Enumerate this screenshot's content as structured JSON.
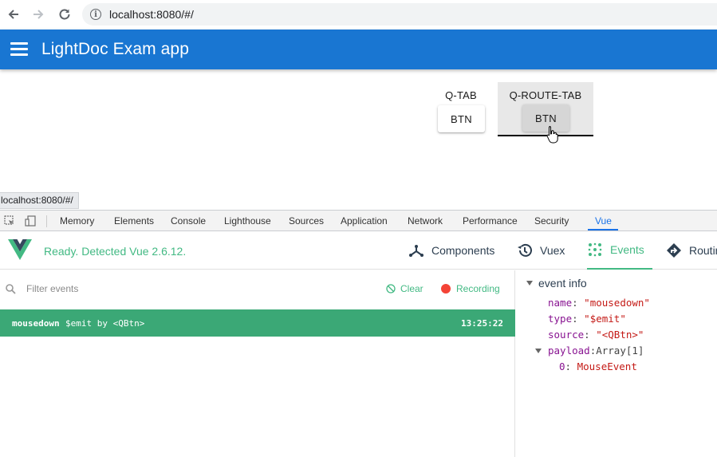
{
  "browser": {
    "url": "localhost:8080/#/"
  },
  "app": {
    "title": "LightDoc Exam app"
  },
  "tabs": [
    {
      "label": "Q-TAB",
      "button": "BTN"
    },
    {
      "label": "Q-ROUTE-TAB",
      "button": "BTN"
    }
  ],
  "status_url": "localhost:8080/#/",
  "devtools": {
    "tabs": [
      "Memory",
      "Elements",
      "Console",
      "Lighthouse",
      "Sources",
      "Application",
      "Network",
      "Performance",
      "Security",
      "Vue"
    ],
    "active_tab": "Vue"
  },
  "vue": {
    "status": "Ready. Detected Vue 2.6.12.",
    "nav": [
      "Components",
      "Vuex",
      "Events",
      "Routing"
    ],
    "active_nav": "Events",
    "filter_placeholder": "Filter events",
    "clear_label": "Clear",
    "recording_label": "Recording",
    "events": [
      {
        "name": "mousedown",
        "type": "$emit by <QBtn>",
        "time": "13:25:22"
      }
    ],
    "event_info": {
      "header": "event info",
      "name_key": "name",
      "name_val": "\"mousedown\"",
      "type_key": "type",
      "type_val": "\"$emit\"",
      "source_key": "source",
      "source_val": "\"<QBtn>\"",
      "payload_key": "payload",
      "payload_val": "Array[1]",
      "item_key": "0",
      "item_val": "MouseEvent"
    }
  },
  "colors": {
    "header_blue": "#1976d2",
    "vue_green": "#42b983",
    "event_row": "#3ba876"
  }
}
